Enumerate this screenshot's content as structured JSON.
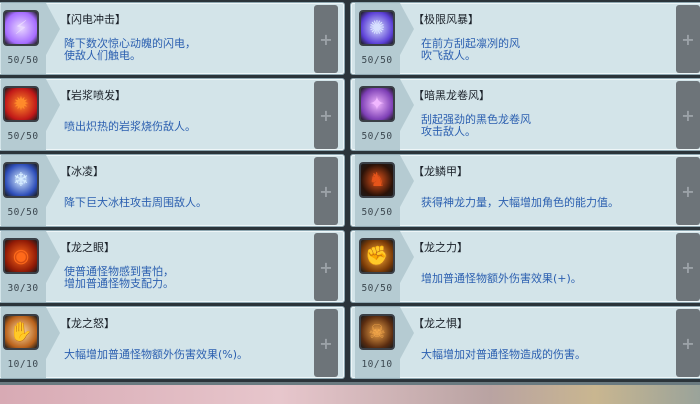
{
  "skills": [
    {
      "name": "【闪电冲击】",
      "description": "降下数次惊心动魄的闪电，\n使敌人们触电。",
      "level": "50/50",
      "icon": "lightning-icon",
      "icon_glyph": "⚡",
      "icon_colors": [
        "#a56cff",
        "#e9d8ff"
      ]
    },
    {
      "name": "【极限风暴】",
      "description": "在前方刮起凛冽的风\n吹飞敌人。",
      "level": "50/50",
      "icon": "storm-icon",
      "icon_glyph": "✺",
      "icon_colors": [
        "#5b3fd6",
        "#d8e1ff"
      ]
    },
    {
      "name": "【岩浆喷发】",
      "description": "喷出炽热的岩浆烧伤敌人。",
      "level": "50/50",
      "icon": "magma-icon",
      "icon_glyph": "✹",
      "icon_colors": [
        "#c01818",
        "#ff8a2a"
      ]
    },
    {
      "name": "【暗黑龙卷风】",
      "description": "刮起强劲的黑色龙卷风\n攻击敌人。",
      "level": "50/50",
      "icon": "tornado-icon",
      "icon_glyph": "✦",
      "icon_colors": [
        "#7d3fb5",
        "#f1b7ff"
      ]
    },
    {
      "name": "【冰凌】",
      "description": "降下巨大冰柱攻击周围敌人。",
      "level": "50/50",
      "icon": "icicle-icon",
      "icon_glyph": "❄",
      "icon_colors": [
        "#2d4db8",
        "#d6ecff"
      ]
    },
    {
      "name": "【龙鳞甲】",
      "description": "获得神龙力量，大幅增加角色的能力值。",
      "level": "50/50",
      "icon": "dragon-armor-icon",
      "icon_glyph": "♞",
      "icon_colors": [
        "#2a1208",
        "#e6541a"
      ]
    },
    {
      "name": "【龙之眼】",
      "description": "使普通怪物感到害怕，\n增加普通怪物支配力。",
      "level": "30/30",
      "icon": "dragon-eye-icon",
      "icon_glyph": "◉",
      "icon_colors": [
        "#8f1a06",
        "#ff6a1a"
      ]
    },
    {
      "name": "【龙之力】",
      "description": "增加普通怪物额外伤害效果(+)。",
      "level": "50/50",
      "icon": "dragon-power-icon",
      "icon_glyph": "✊",
      "icon_colors": [
        "#7a3a06",
        "#ffb23a"
      ]
    },
    {
      "name": "【龙之怒】",
      "description": "大幅增加普通怪物额外伤害效果(%)。",
      "level": "10/10",
      "icon": "dragon-rage-icon",
      "icon_glyph": "✋",
      "icon_colors": [
        "#b8611b",
        "#ffe0a8"
      ]
    },
    {
      "name": "【龙之惧】",
      "description": "大幅增加对普通怪物造成的伤害。",
      "level": "10/10",
      "icon": "dragon-fear-icon",
      "icon_glyph": "☠",
      "icon_colors": [
        "#5a2c10",
        "#f2a64a"
      ]
    }
  ],
  "plus_label": "+"
}
